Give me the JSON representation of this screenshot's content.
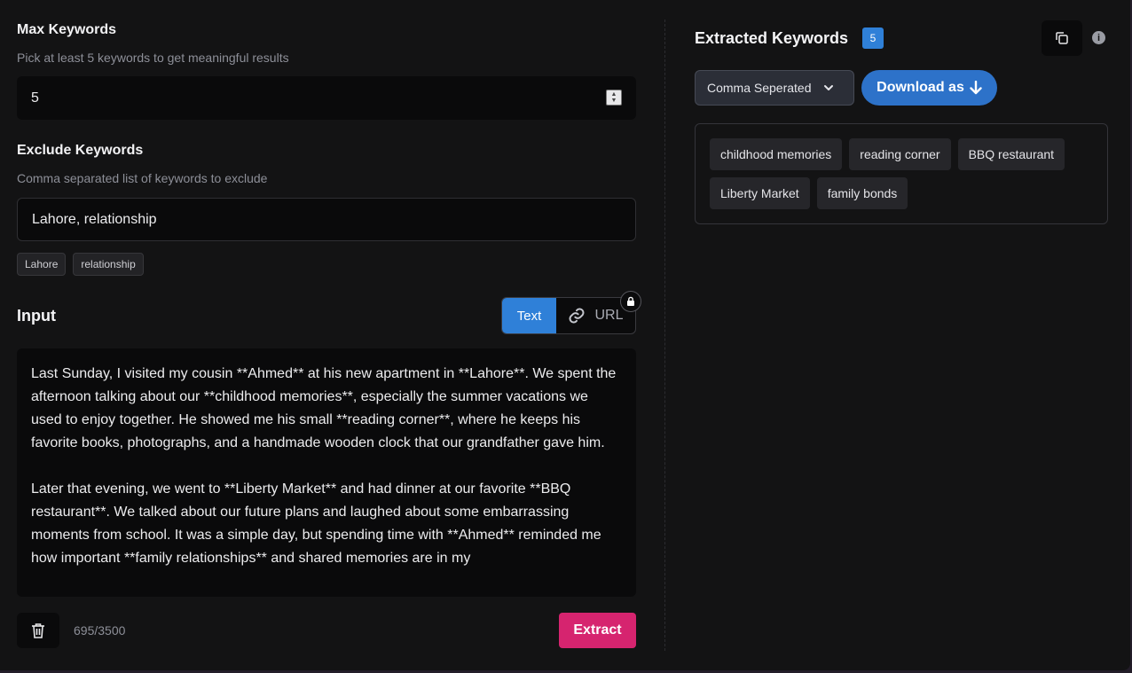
{
  "max_keywords": {
    "label": "Max Keywords",
    "hint": "Pick at least 5 keywords to get meaningful results",
    "value": "5"
  },
  "exclude": {
    "label": "Exclude Keywords",
    "hint": "Comma separated list of keywords to exclude",
    "value": "Lahore, relationship",
    "tags": [
      "Lahore",
      "relationship"
    ]
  },
  "input": {
    "title": "Input",
    "mode_text": "Text",
    "mode_url": "URL",
    "paragraphs": [
      "Last Sunday, I visited my cousin **Ahmed** at his new apartment in **Lahore**. We spent the afternoon talking about our **childhood memories**, especially the summer vacations we used to enjoy together. He showed me his small **reading corner**, where he keeps his favorite books, photographs, and a handmade wooden clock that our grandfather gave him.",
      "Later that evening, we went to **Liberty Market** and had dinner at our favorite **BBQ restaurant**. We talked about our future plans and laughed about some embarrassing moments from school. It was a simple day, but spending time with **Ahmed** reminded me how important **family relationships** and shared memories are in my"
    ],
    "char_count": "695/3500",
    "extract_label": "Extract"
  },
  "output": {
    "title": "Extracted Keywords",
    "count_badge": "5",
    "format_selected": "Comma Seperated",
    "download_label": "Download as",
    "keywords": [
      "childhood memories",
      "reading corner",
      "BBQ restaurant",
      "Liberty Market",
      "family bonds"
    ]
  },
  "colors": {
    "accent_blue": "#2f80d8",
    "extract_pink": "#d6246f",
    "background": "#131314"
  },
  "icons": {
    "trash": "trash-icon",
    "copy": "copy-icon",
    "info": "info-icon",
    "link": "link-icon",
    "lock": "lock-icon",
    "chevron": "chevron-down-icon",
    "arrow": "arrow-down-icon"
  }
}
